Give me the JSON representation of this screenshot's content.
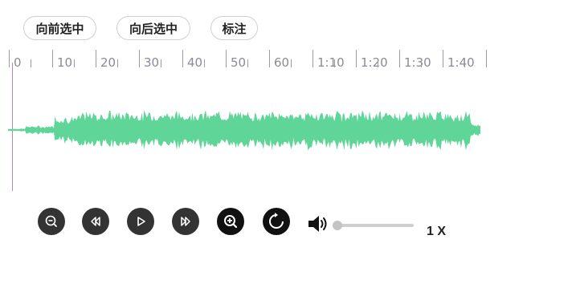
{
  "toolbar": {
    "select_forward": "向前选中",
    "select_backward": "向后选中",
    "annotate": "标注"
  },
  "timeline": {
    "labels": [
      "0",
      "10",
      "20",
      "30",
      "40",
      "50",
      "60",
      "1:10",
      "1:20",
      "1:30",
      "1:40"
    ]
  },
  "waveform": {
    "color": "#5fd597",
    "cursor_color": "#b08ab0"
  },
  "controls": {
    "icons": [
      "zoom-out-icon",
      "rewind-icon",
      "play-icon",
      "fast-forward-icon",
      "zoom-in-icon",
      "refresh-icon",
      "volume-icon"
    ],
    "volume": 0,
    "speed": "1 X"
  }
}
